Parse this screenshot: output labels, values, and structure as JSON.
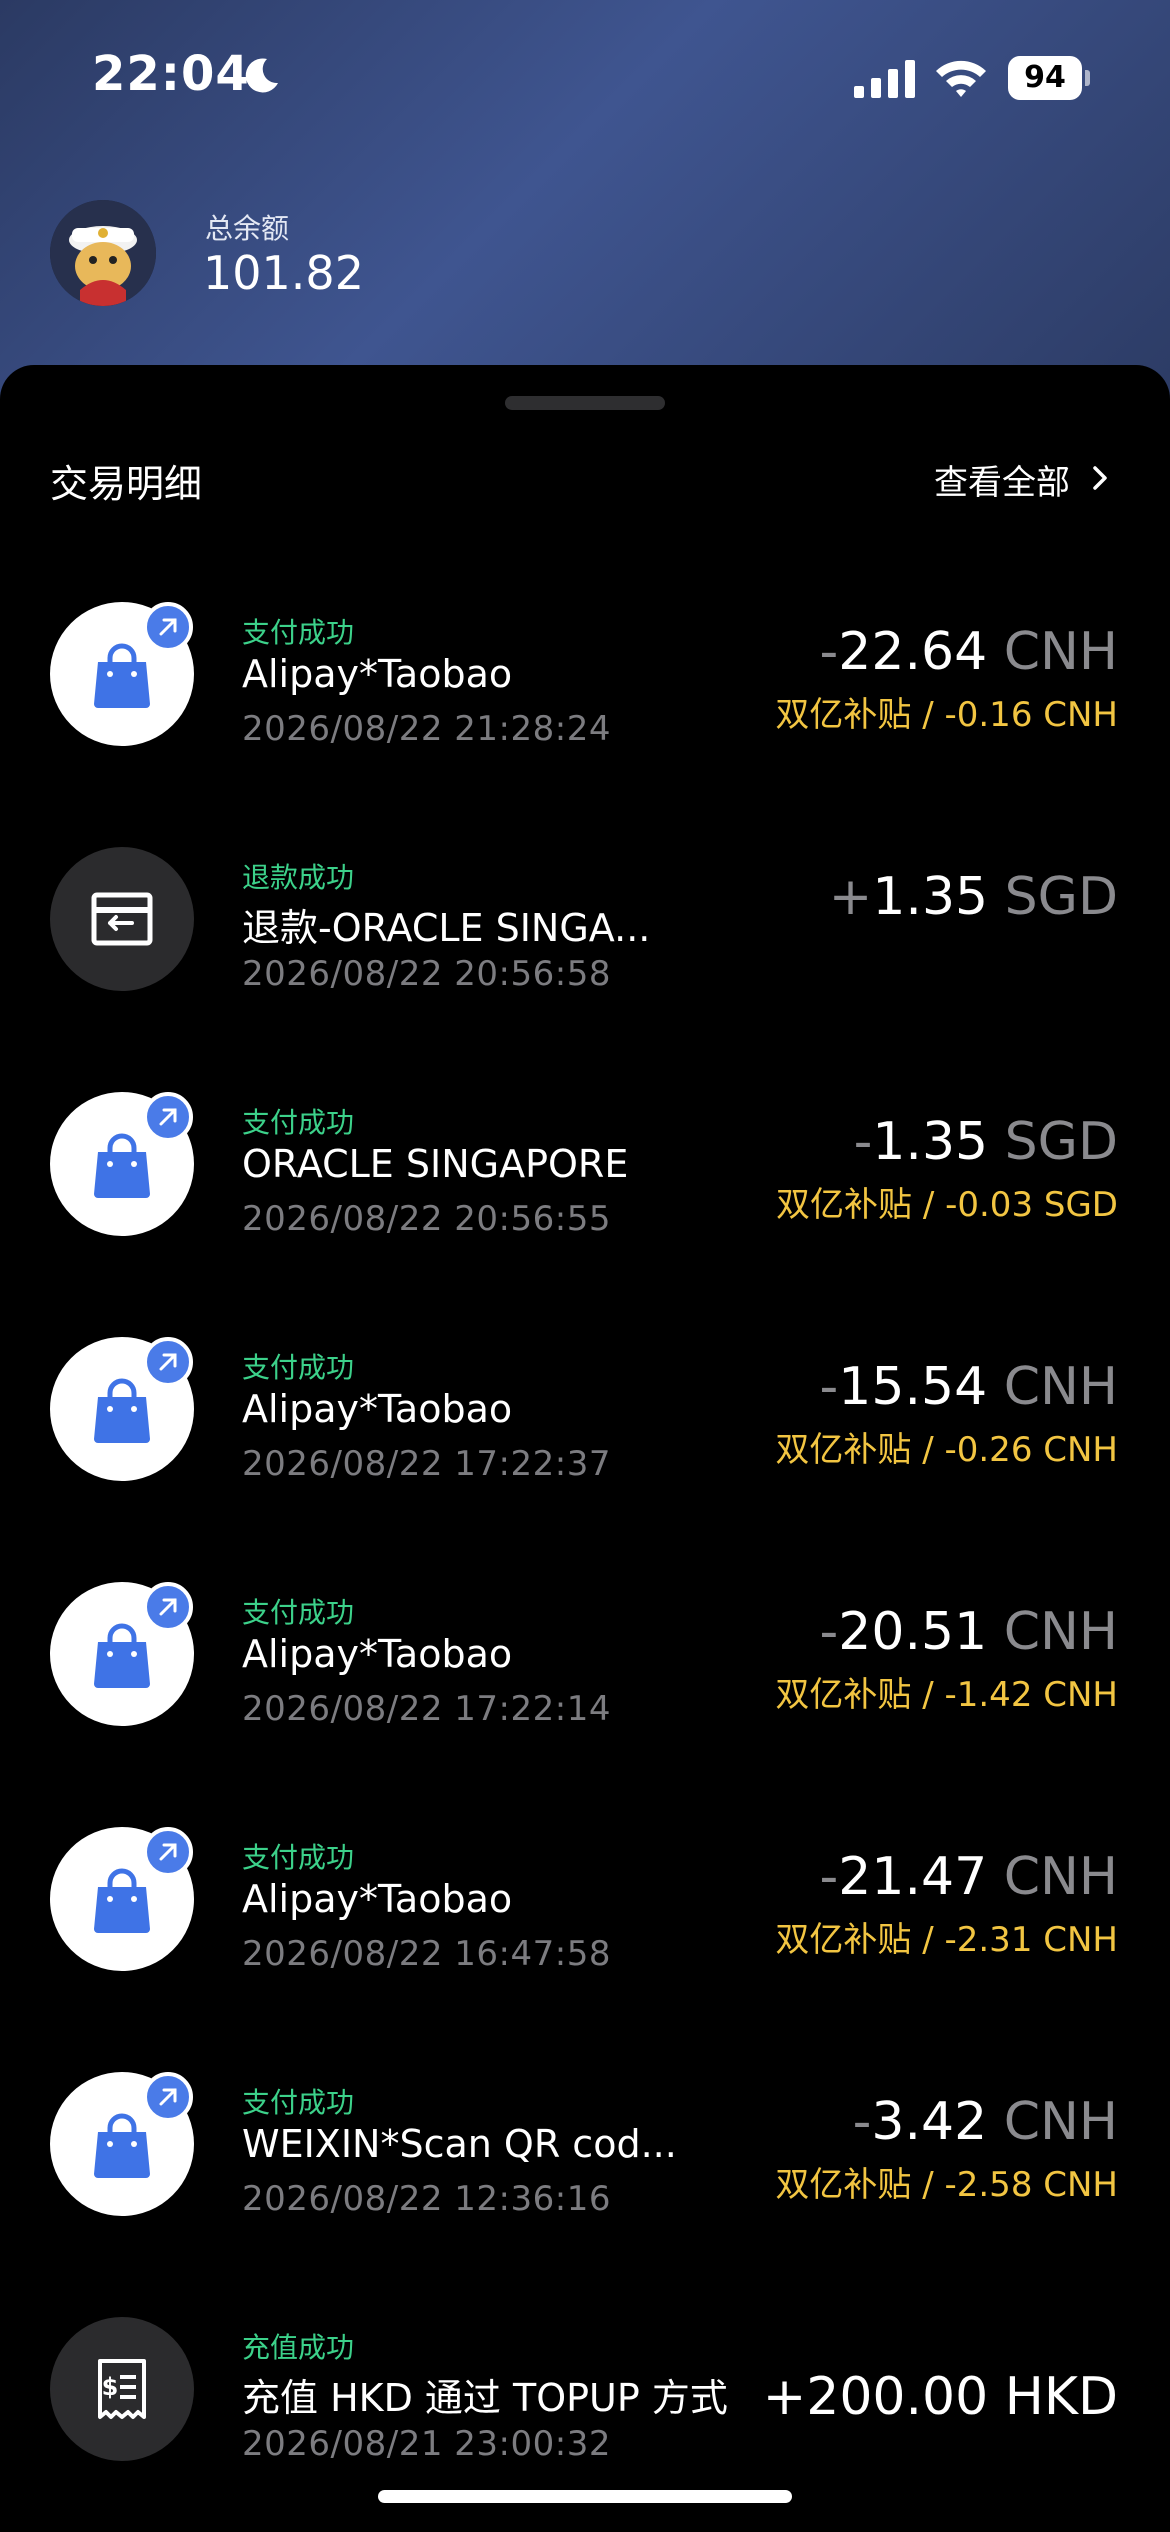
{
  "status_bar": {
    "time": "22:04",
    "battery": "94"
  },
  "account": {
    "balance_label": "总余额",
    "balance_value": "101.82"
  },
  "section": {
    "title": "交易明细",
    "view_all": "查看全部"
  },
  "transactions": [
    {
      "status": "支付成功",
      "merchant": "Alipay*Taobao",
      "time": "2026/08/22 21:28:24",
      "sign": "-",
      "amount": "22.64",
      "currency": "CNH",
      "subsidy": "双亿补贴 / -0.16 CNH",
      "icon": "shopping-bag-icon"
    },
    {
      "status": "退款成功",
      "merchant": "退款-ORACLE  SINGA...",
      "time": "2026/08/22 20:56:58",
      "sign": "+",
      "amount": "1.35",
      "currency": "SGD",
      "subsidy": "",
      "icon": "refund-icon"
    },
    {
      "status": "支付成功",
      "merchant": "ORACLE  SINGAPORE",
      "time": "2026/08/22 20:56:55",
      "sign": "-",
      "amount": "1.35",
      "currency": "SGD",
      "subsidy": "双亿补贴 / -0.03 SGD",
      "icon": "shopping-bag-icon"
    },
    {
      "status": "支付成功",
      "merchant": "Alipay*Taobao",
      "time": "2026/08/22 17:22:37",
      "sign": "-",
      "amount": "15.54",
      "currency": "CNH",
      "subsidy": "双亿补贴 / -0.26 CNH",
      "icon": "shopping-bag-icon"
    },
    {
      "status": "支付成功",
      "merchant": "Alipay*Taobao",
      "time": "2026/08/22 17:22:14",
      "sign": "-",
      "amount": "20.51",
      "currency": "CNH",
      "subsidy": "双亿补贴 / -1.42 CNH",
      "icon": "shopping-bag-icon"
    },
    {
      "status": "支付成功",
      "merchant": "Alipay*Taobao",
      "time": "2026/08/22 16:47:58",
      "sign": "-",
      "amount": "21.47",
      "currency": "CNH",
      "subsidy": "双亿补贴 / -2.31 CNH",
      "icon": "shopping-bag-icon"
    },
    {
      "status": "支付成功",
      "merchant": "WEIXIN*Scan QR cod...",
      "time": "2026/08/22 12:36:16",
      "sign": "-",
      "amount": "3.42",
      "currency": "CNH",
      "subsidy": "双亿补贴 / -2.58 CNH",
      "icon": "shopping-bag-icon"
    },
    {
      "status": "充值成功",
      "merchant": "充值 HKD 通过 TOPUP 方式",
      "time": "2026/08/21 23:00:32",
      "sign": "+",
      "amount": "200.00",
      "currency": "HKD",
      "subsidy": "",
      "icon": "receipt-icon"
    }
  ],
  "colors": {
    "status_green": "#3cd18a",
    "subsidy_yellow": "#f2c542",
    "badge_blue": "#4a7be8",
    "bag_blue": "#3f73e6"
  }
}
